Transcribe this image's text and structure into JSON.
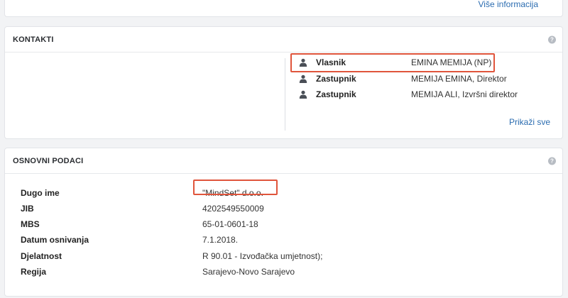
{
  "top_card": {
    "link_label": "Više informacija"
  },
  "contacts": {
    "title": "KONTAKTI",
    "help_glyph": "?",
    "icon": "person-icon",
    "rows": [
      {
        "role": "Vlasnik",
        "name": "EMINA MEMIJA (NP)",
        "highlighted": true
      },
      {
        "role": "Zastupnik",
        "name": "MEMIJA EMINA, Direktor",
        "highlighted": false
      },
      {
        "role": "Zastupnik",
        "name": "MEMIJA ALI, Izvršni direktor",
        "highlighted": false
      }
    ],
    "show_all_label": "Prikaži sve"
  },
  "basic": {
    "title": "OSNOVNI PODACI",
    "help_glyph": "?",
    "rows": [
      {
        "label": "Dugo ime",
        "value": "\"MindSet\" d.o.o.",
        "highlighted": true
      },
      {
        "label": "JIB",
        "value": "4202549550009"
      },
      {
        "label": "MBS",
        "value": "65-01-0601-18"
      },
      {
        "label": "Datum osnivanja",
        "value": "7.1.2018."
      },
      {
        "label": "Djelatnost",
        "value": "R 90.01 - Izvođačka umjetnost);"
      },
      {
        "label": "Regija",
        "value": "Sarajevo-Novo Sarajevo"
      }
    ]
  },
  "colors": {
    "link": "#2b6cb0",
    "highlight_border": "#e0553c",
    "help_icon": "#b7bcc3"
  }
}
